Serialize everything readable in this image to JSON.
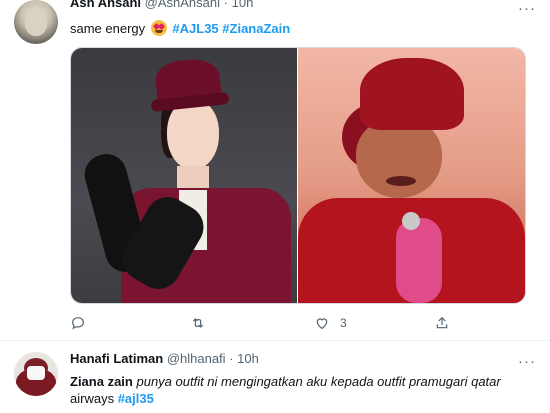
{
  "tweet1": {
    "author_name": "Ash Ansani",
    "handle": "@AshAnsani",
    "dot": "·",
    "time": "10h",
    "text_plain": "same energy",
    "emoji_icon": "heart-eyes-emoji",
    "hashtags": [
      "#AJL35",
      "#ZianaZain"
    ],
    "actions": {
      "reply_count": "",
      "retweet_count": "",
      "like_count": "3"
    }
  },
  "tweet2": {
    "author_name": "Hanafi Latiman",
    "handle": "@hlhanafi",
    "dot": "·",
    "time": "10h",
    "mention_bold": "Ziana zain",
    "text_italic": "punya outfit ni mengingatkan aku kepada outfit pramugari qatar",
    "text_line2": "airways",
    "hashtag": "#ajl35"
  },
  "colors": {
    "link": "#1d9bf0",
    "muted": "#536471",
    "text": "#0f1419",
    "border": "#cfd9de"
  }
}
